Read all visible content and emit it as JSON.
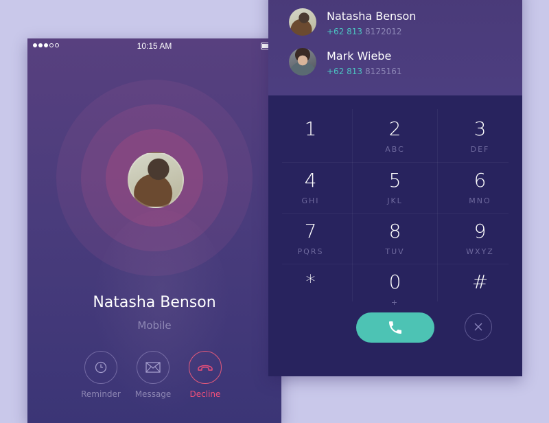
{
  "status_bar": {
    "time": "10:15 AM"
  },
  "incoming_call": {
    "caller_name": "Natasha Benson",
    "caller_type": "Mobile",
    "actions": [
      {
        "label": "Reminder",
        "icon": "clock-icon"
      },
      {
        "label": "Message",
        "icon": "envelope-icon"
      },
      {
        "label": "Decline",
        "icon": "phone-hangup-icon",
        "color": "#f0507a"
      }
    ]
  },
  "recent_contacts": [
    {
      "name": "Natasha Benson",
      "country_code": "+62 813",
      "number": "8172012"
    },
    {
      "name": "Mark Wiebe",
      "country_code": "+62 813",
      "number": "8125161"
    }
  ],
  "keypad": [
    {
      "digit": "1",
      "letters": ""
    },
    {
      "digit": "2",
      "letters": "ABC"
    },
    {
      "digit": "3",
      "letters": "DEF"
    },
    {
      "digit": "4",
      "letters": "GHI"
    },
    {
      "digit": "5",
      "letters": "JKL"
    },
    {
      "digit": "6",
      "letters": "MNO"
    },
    {
      "digit": "7",
      "letters": "PQRS"
    },
    {
      "digit": "8",
      "letters": "TUV"
    },
    {
      "digit": "9",
      "letters": "WXYZ"
    },
    {
      "digit": "*",
      "letters": ""
    },
    {
      "digit": "0",
      "letters": "+"
    },
    {
      "digit": "#",
      "letters": ""
    }
  ],
  "colors": {
    "accent_teal": "#4dc3b4",
    "decline_red": "#f0507a",
    "keypad_bg": "#28235e"
  }
}
